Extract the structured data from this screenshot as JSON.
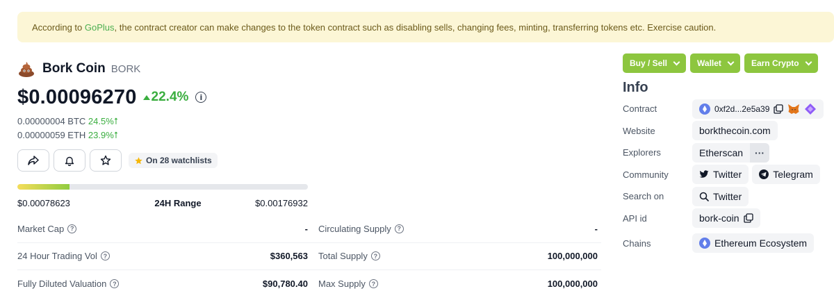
{
  "warning": {
    "prefix": "According to ",
    "link": "GoPlus",
    "suffix": ", the contract creator can make changes to the token contract such as disabling sells, changing fees, minting, transferring tokens etc. Exercise caution."
  },
  "coin": {
    "name": "Bork Coin",
    "symbol": "BORK",
    "price": "$0.00096270",
    "change_24h": "22.4%",
    "btc_price": "0.00000004 BTC",
    "btc_change": "24.5%",
    "eth_price": "0.00000059 ETH",
    "eth_change": "23.9%"
  },
  "watchlist": {
    "label": "On 28 watchlists"
  },
  "range": {
    "low": "$0.00078623",
    "label": "24H Range",
    "high": "$0.00176932",
    "position": 0.18
  },
  "stats": {
    "market_cap": {
      "label": "Market Cap",
      "value": "-"
    },
    "circulating_supply": {
      "label": "Circulating Supply",
      "value": "-"
    },
    "volume": {
      "label": "24 Hour Trading Vol",
      "value": "$360,563"
    },
    "total_supply": {
      "label": "Total Supply",
      "value": "100,000,000"
    },
    "fdv": {
      "label": "Fully Diluted Valuation",
      "value": "$90,780.40"
    },
    "max_supply": {
      "label": "Max Supply",
      "value": "100,000,000"
    }
  },
  "buttons": {
    "buy_sell": "Buy / Sell",
    "wallet": "Wallet",
    "earn": "Earn Crypto"
  },
  "info": {
    "title": "Info",
    "contract_label": "Contract",
    "contract_value": "0xf2d...2e5a39",
    "website_label": "Website",
    "website_value": "borkthecoin.com",
    "explorers_label": "Explorers",
    "explorers_value": "Etherscan",
    "explorers_more": "···",
    "community_label": "Community",
    "twitter": "Twitter",
    "telegram": "Telegram",
    "search_label": "Search on",
    "search_twitter": "Twitter",
    "api_label": "API id",
    "api_value": "bork-coin",
    "chains_label": "Chains",
    "chains_value": "Ethereum Ecosystem"
  },
  "colors": {
    "green_button": "#8dc63f",
    "positive": "#3aae3f",
    "warning_bg": "#fcf6d6"
  }
}
